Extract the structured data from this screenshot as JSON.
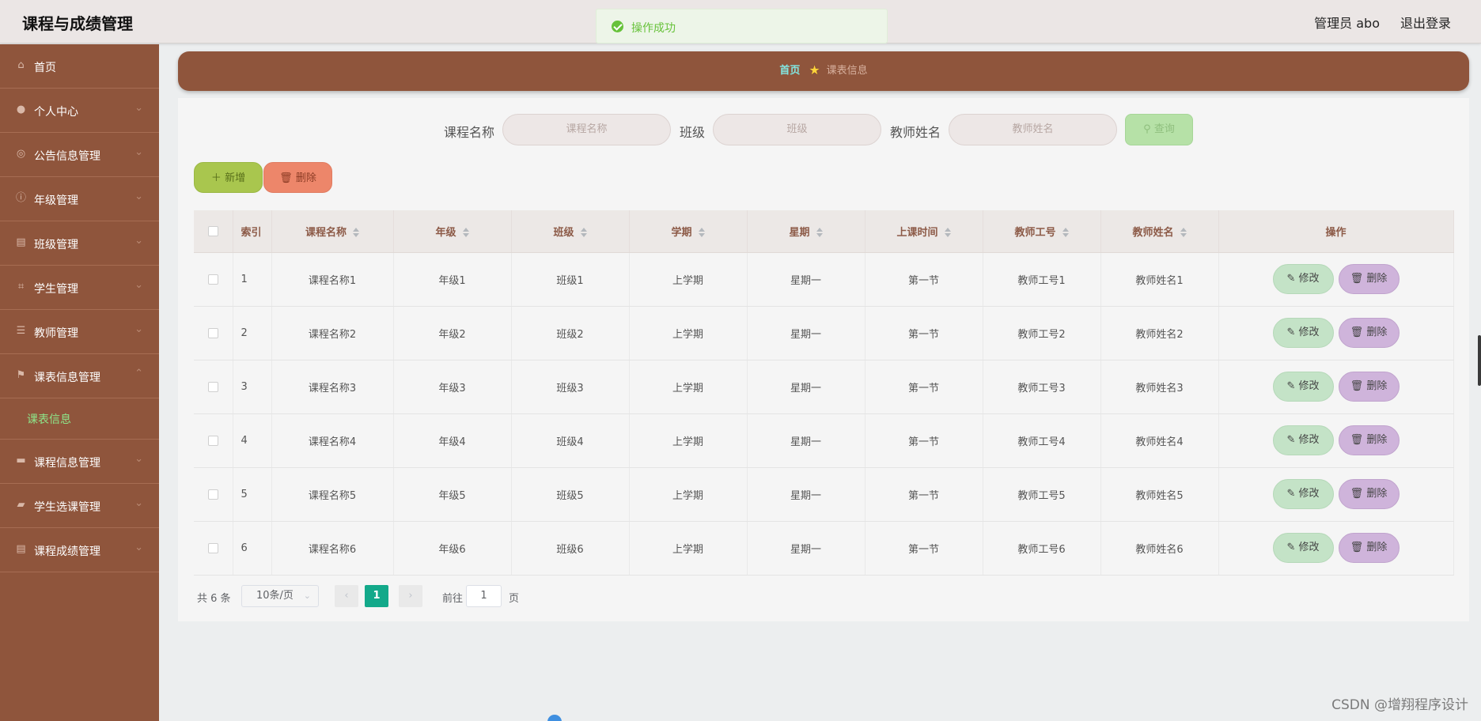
{
  "app": {
    "title": "课程与成绩管理"
  },
  "header": {
    "user": "管理员 abo",
    "logout": "退出登录"
  },
  "toast": {
    "message": "操作成功"
  },
  "sidebar": {
    "items": [
      {
        "label": "首页",
        "icon": "home-icon"
      },
      {
        "label": "个人中心",
        "icon": "user-icon"
      },
      {
        "label": "公告信息管理",
        "icon": "globe-icon"
      },
      {
        "label": "年级管理",
        "icon": "info-icon"
      },
      {
        "label": "班级管理",
        "icon": "clipboard-icon"
      },
      {
        "label": "学生管理",
        "icon": "crop-icon"
      },
      {
        "label": "教师管理",
        "icon": "list-icon"
      },
      {
        "label": "课表信息管理",
        "icon": "flag-icon"
      },
      {
        "label": "课程信息管理",
        "icon": "monitor-icon"
      },
      {
        "label": "学生选课管理",
        "icon": "chat-icon"
      },
      {
        "label": "课程成绩管理",
        "icon": "clipboard-icon"
      }
    ],
    "submenu_active": "课表信息"
  },
  "breadcrumb": {
    "home": "首页",
    "current": "课表信息"
  },
  "search": {
    "course_label": "课程名称",
    "course_placeholder": "课程名称",
    "class_label": "班级",
    "class_placeholder": "班级",
    "teacher_label": "教师姓名",
    "teacher_placeholder": "教师姓名",
    "button": "查询"
  },
  "actions": {
    "add": "新增",
    "delete": "删除"
  },
  "table": {
    "columns": [
      "索引",
      "课程名称",
      "年级",
      "班级",
      "学期",
      "星期",
      "上课时间",
      "教师工号",
      "教师姓名",
      "操作"
    ],
    "rows": [
      {
        "index": "1",
        "course": "课程名称1",
        "grade": "年级1",
        "class": "班级1",
        "term": "上学期",
        "weekday": "星期一",
        "time": "第一节",
        "teacher_no": "教师工号1",
        "teacher_name": "教师姓名1"
      },
      {
        "index": "2",
        "course": "课程名称2",
        "grade": "年级2",
        "class": "班级2",
        "term": "上学期",
        "weekday": "星期一",
        "time": "第一节",
        "teacher_no": "教师工号2",
        "teacher_name": "教师姓名2"
      },
      {
        "index": "3",
        "course": "课程名称3",
        "grade": "年级3",
        "class": "班级3",
        "term": "上学期",
        "weekday": "星期一",
        "time": "第一节",
        "teacher_no": "教师工号3",
        "teacher_name": "教师姓名3"
      },
      {
        "index": "4",
        "course": "课程名称4",
        "grade": "年级4",
        "class": "班级4",
        "term": "上学期",
        "weekday": "星期一",
        "time": "第一节",
        "teacher_no": "教师工号4",
        "teacher_name": "教师姓名4"
      },
      {
        "index": "5",
        "course": "课程名称5",
        "grade": "年级5",
        "class": "班级5",
        "term": "上学期",
        "weekday": "星期一",
        "time": "第一节",
        "teacher_no": "教师工号5",
        "teacher_name": "教师姓名5"
      },
      {
        "index": "6",
        "course": "课程名称6",
        "grade": "年级6",
        "class": "班级6",
        "term": "上学期",
        "weekday": "星期一",
        "time": "第一节",
        "teacher_no": "教师工号6",
        "teacher_name": "教师姓名6"
      }
    ],
    "edit_label": "修改",
    "delete_label": "删除"
  },
  "pagination": {
    "total": "共 6 条",
    "page_size": "10条/页",
    "current_page": "1",
    "goto_label": "前往",
    "goto_value": "1",
    "page_suffix": "页"
  },
  "watermark": "CSDN @增翔程序设计",
  "colors": {
    "sidebar": "#8f553c",
    "accent_green": "#13a98a",
    "submenu_active": "#8ee68a"
  }
}
